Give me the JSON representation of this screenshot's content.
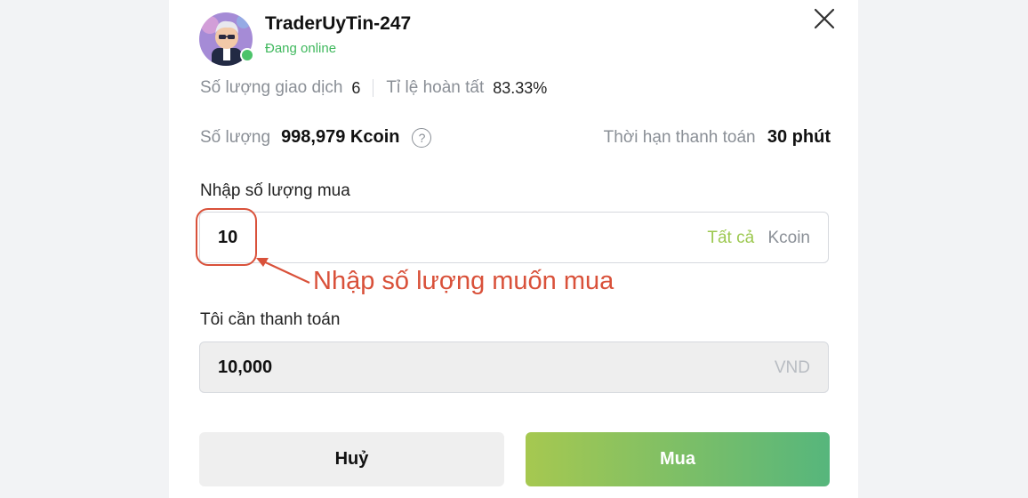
{
  "trader": {
    "name": "TraderUyTin-247",
    "status": "Đang online"
  },
  "stats": {
    "trades_label": "Số lượng giao dịch",
    "trades_value": "6",
    "completion_label": "Tỉ lệ hoàn tất",
    "completion_value": "83.33%"
  },
  "amount": {
    "label": "Số lượng",
    "value": "998,979 Kcoin",
    "help_icon": "question-circle-icon"
  },
  "deadline": {
    "label": "Thời hạn thanh toán",
    "value": "30 phút"
  },
  "buy_input": {
    "label": "Nhập số lượng mua",
    "value": "10",
    "all_label": "Tất cả",
    "unit": "Kcoin"
  },
  "annotation": {
    "text": "Nhập số lượng muốn mua",
    "color": "#d9513a"
  },
  "pay_input": {
    "label": "Tôi cần thanh toán",
    "value": "10,000",
    "unit": "VND"
  },
  "buttons": {
    "cancel": "Huỷ",
    "buy": "Mua"
  },
  "colors": {
    "accent_green": "#3fb85d",
    "buy_gradient_start": "#a6c850",
    "buy_gradient_end": "#56b67c",
    "all_link": "#9cc84f"
  }
}
